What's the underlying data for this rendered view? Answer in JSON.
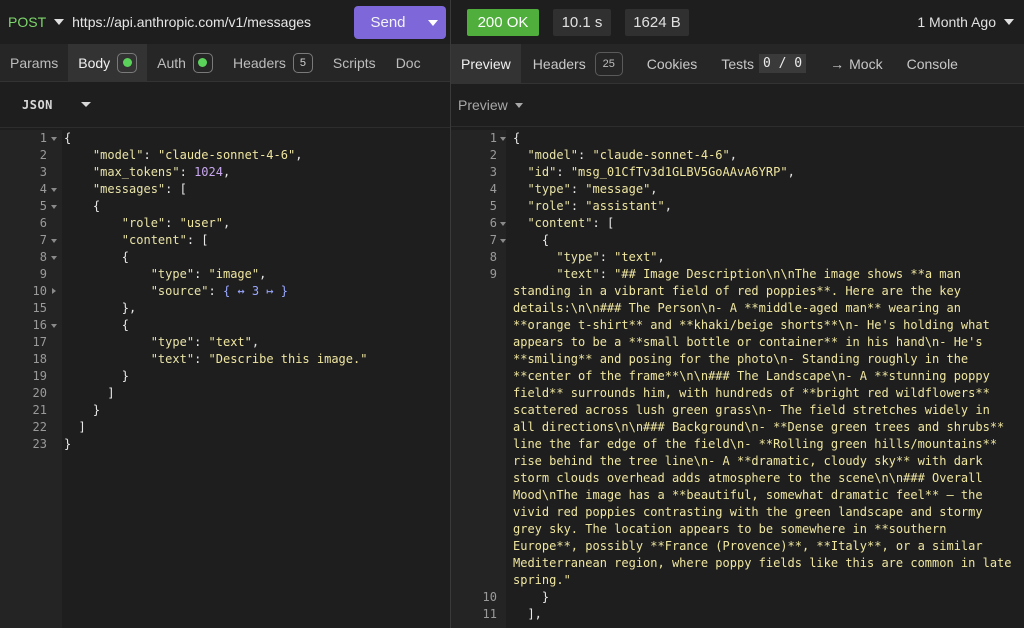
{
  "request": {
    "method": "POST",
    "url": "https://api.anthropic.com/v1/messages",
    "send_label": "Send",
    "tabs": [
      {
        "label": "Params"
      },
      {
        "label": "Body",
        "badge": "dot"
      },
      {
        "label": "Auth",
        "badge": "dot"
      },
      {
        "label": "Headers",
        "badge": "5"
      },
      {
        "label": "Scripts"
      },
      {
        "label": "Doc"
      }
    ],
    "body_format": "JSON"
  },
  "response": {
    "status": "200 OK",
    "time": "10.1 s",
    "size": "1624 B",
    "history": "1 Month Ago",
    "tabs": [
      {
        "label": "Preview"
      },
      {
        "label": "Headers",
        "badge": "25"
      },
      {
        "label": "Cookies"
      },
      {
        "label": "Tests",
        "count": "0 / 0"
      },
      {
        "label": "Mock",
        "prefix": "→"
      },
      {
        "label": "Console"
      }
    ],
    "preview_mode": "Preview"
  },
  "request_code": [
    {
      "n": "1",
      "fold": "open",
      "indent": "",
      "key": "",
      "value": "",
      "vtype": "",
      "punct": "{"
    },
    {
      "n": "2",
      "indent": "    ",
      "key": "\"model\"",
      "sep": ": ",
      "value": "\"claude-sonnet-4-6\"",
      "vtype": "s",
      "punct": ","
    },
    {
      "n": "3",
      "indent": "    ",
      "key": "\"max_tokens\"",
      "sep": ": ",
      "value": "1024",
      "vtype": "n",
      "punct": ","
    },
    {
      "n": "4",
      "fold": "open",
      "indent": "    ",
      "key": "\"messages\"",
      "sep": ": ",
      "value": "",
      "vtype": "",
      "punct": "["
    },
    {
      "n": "5",
      "fold": "open",
      "indent": "    ",
      "key": "",
      "value": "",
      "vtype": "",
      "punct": "{"
    },
    {
      "n": "6",
      "indent": "        ",
      "key": "\"role\"",
      "sep": ": ",
      "value": "\"user\"",
      "vtype": "s",
      "punct": ","
    },
    {
      "n": "7",
      "fold": "open",
      "indent": "        ",
      "key": "\"content\"",
      "sep": ": ",
      "value": "",
      "vtype": "",
      "punct": "["
    },
    {
      "n": "8",
      "fold": "open",
      "indent": "        ",
      "key": "",
      "value": "",
      "vtype": "",
      "punct": "{"
    },
    {
      "n": "9",
      "indent": "            ",
      "key": "\"type\"",
      "sep": ": ",
      "value": "\"image\"",
      "vtype": "s",
      "punct": ","
    },
    {
      "n": "10",
      "fold": "closed",
      "indent": "            ",
      "key": "\"source\"",
      "sep": ": ",
      "value": "{ ↔ 3 ↦ }",
      "vtype": "coll",
      "punct": ""
    },
    {
      "n": "15",
      "indent": "        ",
      "key": "",
      "value": "",
      "vtype": "",
      "punct": "},"
    },
    {
      "n": "16",
      "fold": "open",
      "indent": "        ",
      "key": "",
      "value": "",
      "vtype": "",
      "punct": "{"
    },
    {
      "n": "17",
      "indent": "            ",
      "key": "\"type\"",
      "sep": ": ",
      "value": "\"text\"",
      "vtype": "s",
      "punct": ","
    },
    {
      "n": "18",
      "indent": "            ",
      "key": "\"text\"",
      "sep": ": ",
      "value": "\"Describe this image.\"",
      "vtype": "s",
      "punct": ""
    },
    {
      "n": "19",
      "indent": "        ",
      "key": "",
      "value": "",
      "vtype": "",
      "punct": "}"
    },
    {
      "n": "20",
      "indent": "      ",
      "key": "",
      "value": "",
      "vtype": "",
      "punct": "]"
    },
    {
      "n": "21",
      "indent": "    ",
      "key": "",
      "value": "",
      "vtype": "",
      "punct": "}"
    },
    {
      "n": "22",
      "indent": "  ",
      "key": "",
      "value": "",
      "vtype": "",
      "punct": "]"
    },
    {
      "n": "23",
      "indent": "",
      "key": "",
      "value": "",
      "vtype": "",
      "punct": "}"
    }
  ],
  "response_code": [
    {
      "n": "1",
      "fold": "open",
      "indent": "",
      "key": "",
      "value": "",
      "vtype": "",
      "punct": "{"
    },
    {
      "n": "2",
      "indent": "  ",
      "key": "\"model\"",
      "sep": ": ",
      "value": "\"claude-sonnet-4-6\"",
      "vtype": "s",
      "punct": ","
    },
    {
      "n": "3",
      "indent": "  ",
      "key": "\"id\"",
      "sep": ": ",
      "value": "\"msg_01CfTv3d1GLBV5GoAAvA6YRP\"",
      "vtype": "s",
      "punct": ","
    },
    {
      "n": "4",
      "indent": "  ",
      "key": "\"type\"",
      "sep": ": ",
      "value": "\"message\"",
      "vtype": "s",
      "punct": ","
    },
    {
      "n": "5",
      "indent": "  ",
      "key": "\"role\"",
      "sep": ": ",
      "value": "\"assistant\"",
      "vtype": "s",
      "punct": ","
    },
    {
      "n": "6",
      "fold": "open",
      "indent": "  ",
      "key": "\"content\"",
      "sep": ": ",
      "value": "",
      "vtype": "",
      "punct": "["
    },
    {
      "n": "7",
      "fold": "open",
      "indent": "    ",
      "key": "",
      "value": "",
      "vtype": "",
      "punct": "{"
    },
    {
      "n": "8",
      "indent": "      ",
      "key": "\"type\"",
      "sep": ": ",
      "value": "\"text\"",
      "vtype": "s",
      "punct": ","
    },
    {
      "n": "9",
      "wrap": true,
      "first": "      \"text\": \"## Image Description\\n\\nThe image shows **a man",
      "rest": "standing in a vibrant field of red poppies**. Here are the key details:\\n\\n### The Person\\n- A **middle-aged man** wearing an **orange t-shirt** and **khaki/beige shorts**\\n- He's holding what appears to be a **small bottle or container** in his hand\\n- He's **smiling** and posing for the photo\\n- Standing roughly in the **center of the frame**\\n\\n### The Landscape\\n- A **stunning poppy field** surrounds him, with hundreds of **bright red wildflowers** scattered across lush green grass\\n- The field stretches widely in all directions\\n\\n### Background\\n- **Dense green trees and shrubs** line the far edge of the field\\n- **Rolling green hills/mountains** rise behind the tree line\\n- A **dramatic, cloudy sky** with dark storm clouds overhead adds atmosphere to the scene\\n\\n### Overall Mood\\nThe image has a **beautiful, somewhat dramatic feel** — the vivid red poppies contrasting with the green landscape and stormy grey sky. The location appears to be somewhere in **southern Europe**, possibly **France (Provence)**, **Italy**, or a similar Mediterranean region, where poppy fields like this are common in late spring.\""
    },
    {
      "n": "10",
      "indent": "    ",
      "key": "",
      "value": "",
      "vtype": "",
      "punct": "}"
    },
    {
      "n": "11",
      "indent": "  ",
      "key": "",
      "value": "",
      "vtype": "",
      "punct": "],"
    }
  ],
  "colors": {
    "accent": "#7e67d8",
    "method": "#7dd66b",
    "status_ok": "#4fae3c",
    "active_dot": "#5bd35b",
    "json_key": "#e8e3a8",
    "json_string": "#efe6a0",
    "json_number": "#c9a8f0"
  }
}
